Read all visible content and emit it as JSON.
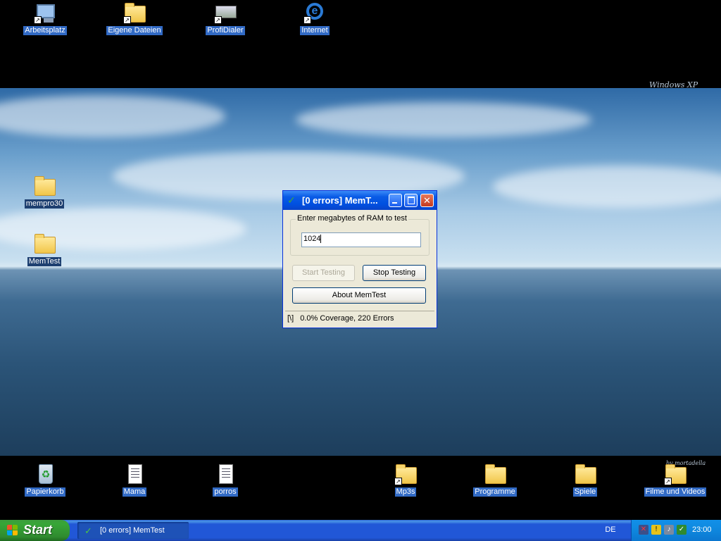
{
  "desktop": {
    "top_icons": [
      {
        "label": "Arbeitsplatz"
      },
      {
        "label": "Eigene Dateien"
      },
      {
        "label": "ProfiDialer"
      },
      {
        "label": "Internet"
      }
    ],
    "left_icons": [
      {
        "label": "mempro30"
      },
      {
        "label": "MemTest"
      }
    ],
    "bottom_icons": [
      {
        "label": "Papierkorb"
      },
      {
        "label": "Mama"
      },
      {
        "label": "porros"
      },
      {
        "label": "Mp3s"
      },
      {
        "label": "Programme"
      },
      {
        "label": "Spiele"
      },
      {
        "label": "Filme und Videos"
      }
    ],
    "wallpaper_watermark": "Windows XP",
    "wallpaper_signature": "by mortadella"
  },
  "memtest_window": {
    "title": "[0 errors] MemT...",
    "group_label": "Enter megabytes of RAM to test",
    "ram_input_value": "1024",
    "start_button": "Start Testing",
    "start_enabled": false,
    "stop_button": "Stop Testing",
    "about_button": "About MemTest",
    "status_spinner": "[\\]",
    "status_text": "0.0% Coverage, 220 Errors"
  },
  "taskbar": {
    "start_label": "Start",
    "task_button": "[0 errors] MemTest",
    "language": "DE",
    "clock": "23:00",
    "tray_icons": [
      "network-disconnected-icon",
      "security-warning-icon",
      "speaker-icon",
      "memtest-tray-icon"
    ]
  },
  "colors": {
    "taskbar_blue": "#2157d7",
    "start_green": "#37a637",
    "title_blue": "#0050e0",
    "close_red": "#c4391e",
    "selection_blue": "#316ac5"
  }
}
